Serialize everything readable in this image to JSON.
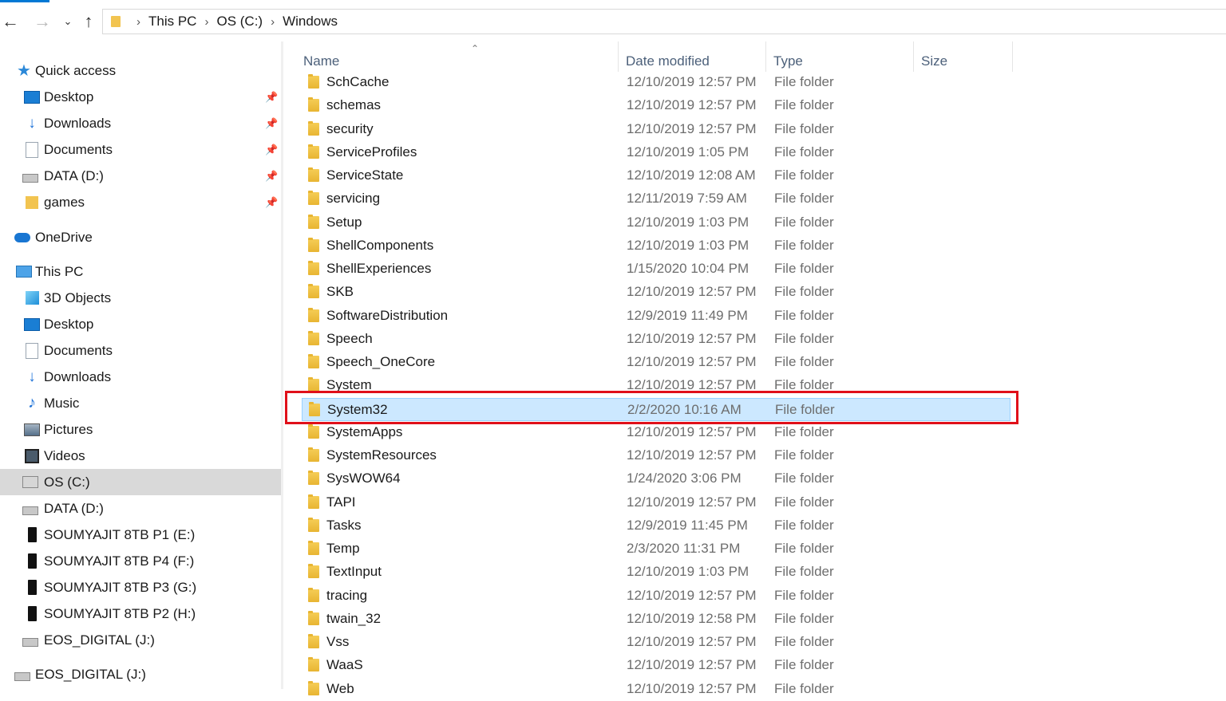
{
  "toolbar": {
    "back_icon": "arrow-left-icon",
    "forward_icon": "arrow-right-icon",
    "recent_icon": "chevron-down-icon",
    "up_icon": "arrow-up-icon"
  },
  "address": {
    "crumbs": [
      "This PC",
      "OS (C:)",
      "Windows"
    ]
  },
  "sidebar": {
    "items": [
      {
        "label": "Quick access",
        "icon": "star-icon",
        "pinned": false
      },
      {
        "label": "Desktop",
        "icon": "desktop-icon",
        "pinned": true
      },
      {
        "label": "Downloads",
        "icon": "download-icon",
        "pinned": true
      },
      {
        "label": "Documents",
        "icon": "documents-icon",
        "pinned": true
      },
      {
        "label": "DATA (D:)",
        "icon": "drive-icon",
        "pinned": true
      },
      {
        "label": "games",
        "icon": "folder-icon",
        "pinned": true
      },
      {
        "label": "OneDrive",
        "icon": "onedrive-icon",
        "pinned": false
      },
      {
        "label": "This PC",
        "icon": "this-pc-icon",
        "pinned": false
      },
      {
        "label": "3D Objects",
        "icon": "3d-objects-icon",
        "pinned": false
      },
      {
        "label": "Desktop",
        "icon": "desktop-icon",
        "pinned": false
      },
      {
        "label": "Documents",
        "icon": "documents-icon",
        "pinned": false
      },
      {
        "label": "Downloads",
        "icon": "download-icon",
        "pinned": false
      },
      {
        "label": "Music",
        "icon": "music-icon",
        "pinned": false
      },
      {
        "label": "Pictures",
        "icon": "pictures-icon",
        "pinned": false
      },
      {
        "label": "Videos",
        "icon": "videos-icon",
        "pinned": false
      },
      {
        "label": "OS (C:)",
        "icon": "windows-drive-icon",
        "pinned": false
      },
      {
        "label": "DATA (D:)",
        "icon": "drive-icon",
        "pinned": false
      },
      {
        "label": "SOUMYAJIT 8TB P1 (E:)",
        "icon": "external-drive-icon",
        "pinned": false
      },
      {
        "label": "SOUMYAJIT 8TB P4 (F:)",
        "icon": "external-drive-icon",
        "pinned": false
      },
      {
        "label": "SOUMYAJIT 8TB P3 (G:)",
        "icon": "external-drive-icon",
        "pinned": false
      },
      {
        "label": "SOUMYAJIT 8TB P2 (H:)",
        "icon": "external-drive-icon",
        "pinned": false
      },
      {
        "label": "EOS_DIGITAL (J:)",
        "icon": "removable-drive-icon",
        "pinned": false
      },
      {
        "label": "EOS_DIGITAL (J:)",
        "icon": "removable-drive-icon",
        "pinned": false
      }
    ],
    "selected_label": "OS (C:)"
  },
  "columns": {
    "name": "Name",
    "date": "Date modified",
    "type": "Type",
    "size": "Size"
  },
  "files": [
    {
      "name": "SchCache",
      "date": "12/10/2019 12:57 PM",
      "type": "File folder"
    },
    {
      "name": "schemas",
      "date": "12/10/2019 12:57 PM",
      "type": "File folder"
    },
    {
      "name": "security",
      "date": "12/10/2019 12:57 PM",
      "type": "File folder"
    },
    {
      "name": "ServiceProfiles",
      "date": "12/10/2019 1:05 PM",
      "type": "File folder"
    },
    {
      "name": "ServiceState",
      "date": "12/10/2019 12:08 AM",
      "type": "File folder"
    },
    {
      "name": "servicing",
      "date": "12/11/2019 7:59 AM",
      "type": "File folder"
    },
    {
      "name": "Setup",
      "date": "12/10/2019 1:03 PM",
      "type": "File folder"
    },
    {
      "name": "ShellComponents",
      "date": "12/10/2019 1:03 PM",
      "type": "File folder"
    },
    {
      "name": "ShellExperiences",
      "date": "1/15/2020 10:04 PM",
      "type": "File folder"
    },
    {
      "name": "SKB",
      "date": "12/10/2019 12:57 PM",
      "type": "File folder"
    },
    {
      "name": "SoftwareDistribution",
      "date": "12/9/2019 11:49 PM",
      "type": "File folder"
    },
    {
      "name": "Speech",
      "date": "12/10/2019 12:57 PM",
      "type": "File folder"
    },
    {
      "name": "Speech_OneCore",
      "date": "12/10/2019 12:57 PM",
      "type": "File folder"
    },
    {
      "name": "System",
      "date": "12/10/2019 12:57 PM",
      "type": "File folder"
    },
    {
      "name": "System32",
      "date": "2/2/2020 10:16 AM",
      "type": "File folder",
      "selected": true
    },
    {
      "name": "SystemApps",
      "date": "12/10/2019 12:57 PM",
      "type": "File folder"
    },
    {
      "name": "SystemResources",
      "date": "12/10/2019 12:57 PM",
      "type": "File folder"
    },
    {
      "name": "SysWOW64",
      "date": "1/24/2020 3:06 PM",
      "type": "File folder"
    },
    {
      "name": "TAPI",
      "date": "12/10/2019 12:57 PM",
      "type": "File folder"
    },
    {
      "name": "Tasks",
      "date": "12/9/2019 11:45 PM",
      "type": "File folder"
    },
    {
      "name": "Temp",
      "date": "2/3/2020 11:31 PM",
      "type": "File folder"
    },
    {
      "name": "TextInput",
      "date": "12/10/2019 1:03 PM",
      "type": "File folder"
    },
    {
      "name": "tracing",
      "date": "12/10/2019 12:57 PM",
      "type": "File folder"
    },
    {
      "name": "twain_32",
      "date": "12/10/2019 12:58 PM",
      "type": "File folder"
    },
    {
      "name": "Vss",
      "date": "12/10/2019 12:57 PM",
      "type": "File folder"
    },
    {
      "name": "WaaS",
      "date": "12/10/2019 12:57 PM",
      "type": "File folder"
    },
    {
      "name": "Web",
      "date": "12/10/2019 12:57 PM",
      "type": "File folder"
    }
  ],
  "colors": {
    "accent": "#0078d4",
    "selection": "#cce8ff",
    "highlight_border": "#e0101a",
    "folder": "#f2c450"
  }
}
